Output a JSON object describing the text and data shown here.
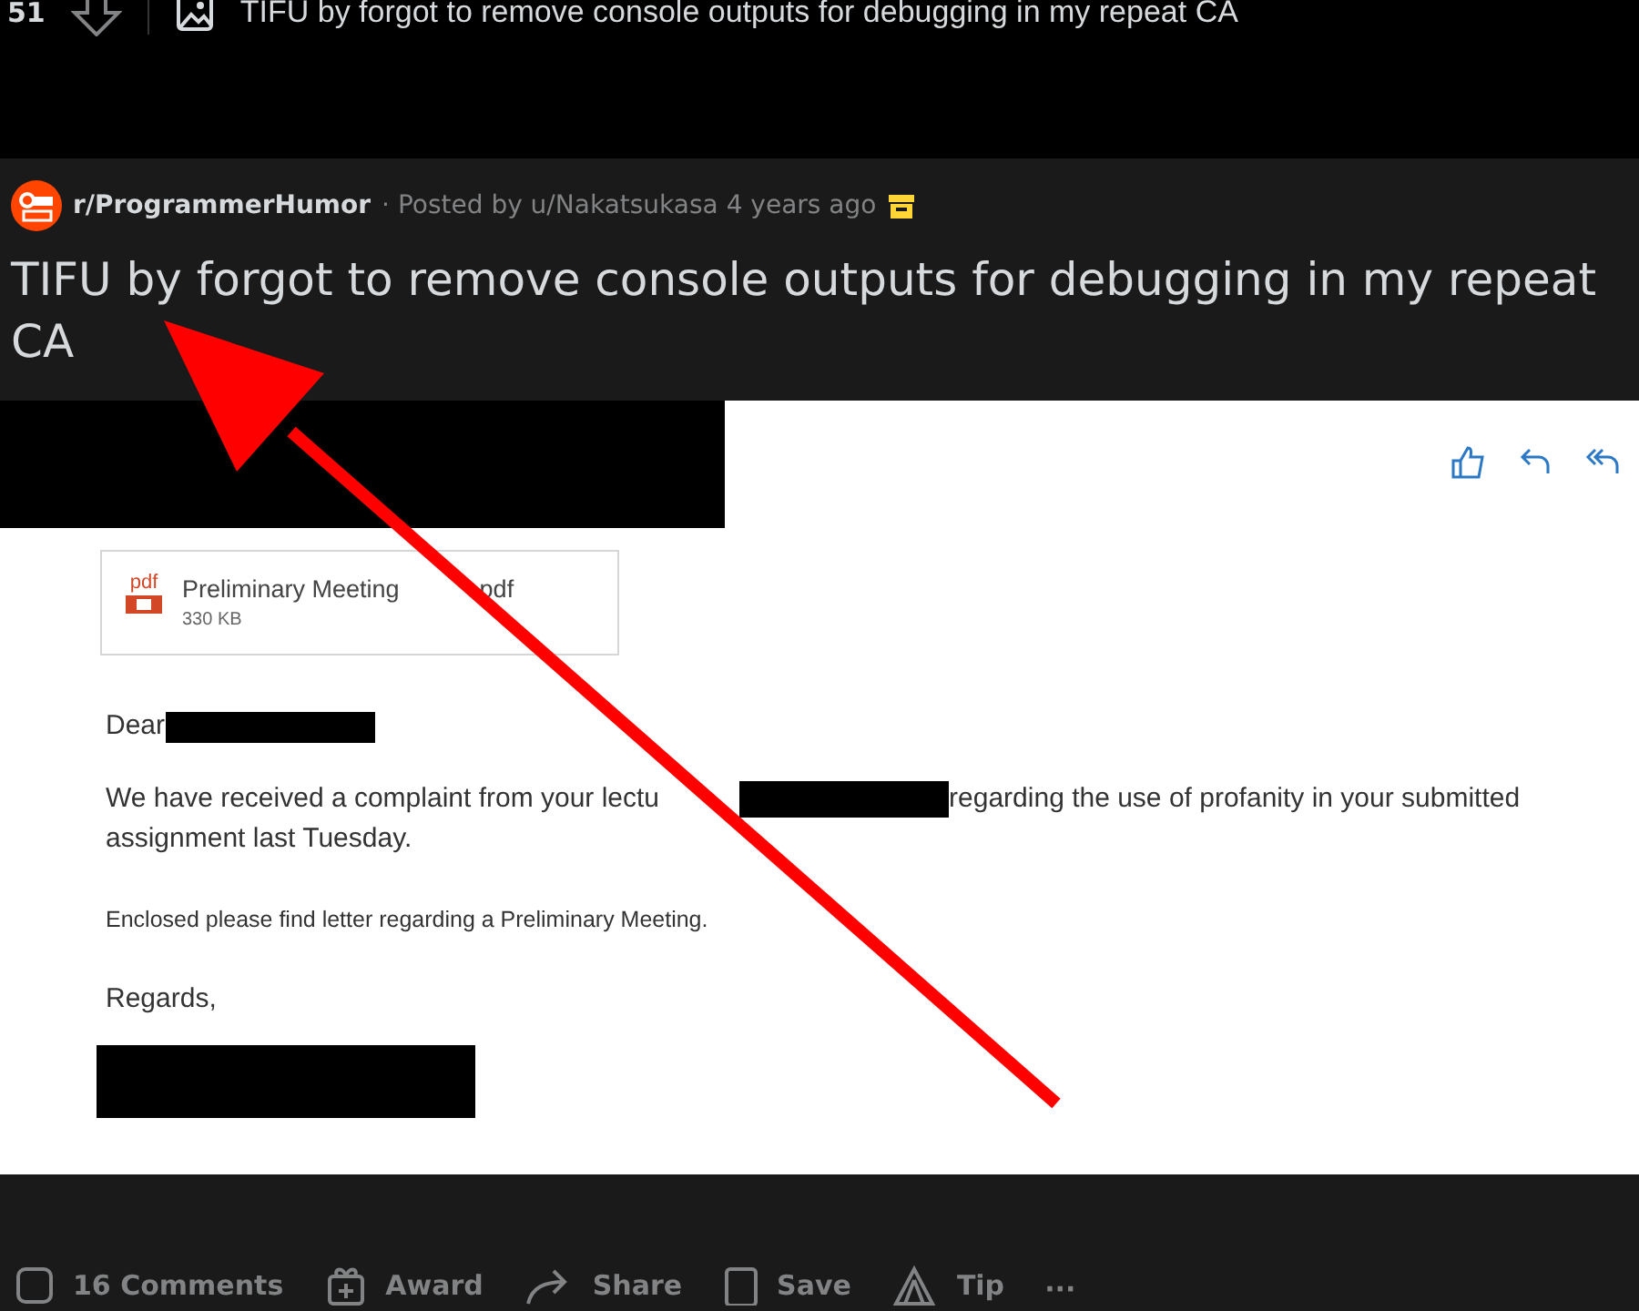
{
  "top_bar": {
    "vote_count": "51",
    "title": "TIFU by forgot to remove console outputs for debugging in my repeat CA"
  },
  "post": {
    "subreddit": "r/ProgrammerHumor",
    "posted_by": "· Posted by u/Nakatsukasa 4 years ago",
    "title": "TIFU by forgot to remove console outputs for debugging in my repeat CA"
  },
  "email": {
    "attachment": {
      "file_type": "pdf",
      "name": "Preliminary Meeting",
      "name_end": "pdf",
      "size": "330 KB"
    },
    "greeting": "Dear",
    "paragraph_start": "We have received a complaint from your lectu",
    "paragraph_end": "regarding the use of profanity in your submitted",
    "paragraph_last_line": "assignment last Tuesday.",
    "note": "Enclosed please find letter regarding a Preliminary Meeting.",
    "closing": "Regards,"
  },
  "actions": [
    {
      "kind": "comments",
      "label": "16 Comments"
    },
    {
      "kind": "award",
      "label": "Award"
    },
    {
      "kind": "share",
      "label": "Share"
    },
    {
      "kind": "save",
      "label": "Save"
    },
    {
      "kind": "tip",
      "label": "Tip"
    },
    {
      "kind": "more",
      "label": "···"
    }
  ]
}
